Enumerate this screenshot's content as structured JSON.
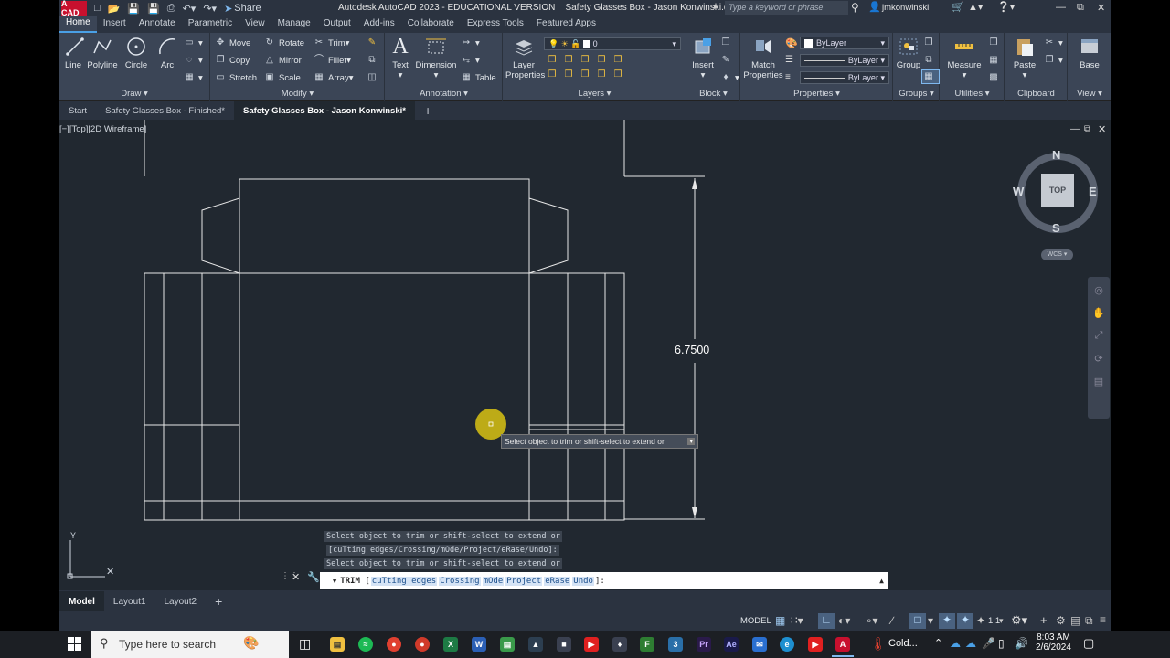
{
  "app": {
    "logo": "A CAD",
    "title": "Autodesk AutoCAD 2023 - EDUCATIONAL VERSION",
    "document": "Safety Glasses Box - Jason Konwinski.dwg",
    "share_label": "Share",
    "search_placeholder": "Type a keyword or phrase",
    "user": "jmkonwinski"
  },
  "menu_tabs": [
    "Home",
    "Insert",
    "Annotate",
    "Parametric",
    "View",
    "Manage",
    "Output",
    "Add-ins",
    "Collaborate",
    "Express Tools",
    "Featured Apps"
  ],
  "ribbon": {
    "draw": {
      "title": "Draw",
      "line": "Line",
      "polyline": "Polyline",
      "circle": "Circle",
      "arc": "Arc"
    },
    "modify": {
      "title": "Modify",
      "move": "Move",
      "rotate": "Rotate",
      "trim": "Trim",
      "copy": "Copy",
      "mirror": "Mirror",
      "fillet": "Fillet",
      "stretch": "Stretch",
      "scale": "Scale",
      "array": "Array"
    },
    "annotation": {
      "title": "Annotation",
      "text": "Text",
      "dimension": "Dimension",
      "table": "Table"
    },
    "layers": {
      "title": "Layers",
      "layer_properties_1": "Layer",
      "layer_properties_2": "Properties",
      "current_layer": "0"
    },
    "block": {
      "title": "Block",
      "insert": "Insert"
    },
    "properties": {
      "title": "Properties",
      "match_1": "Match",
      "match_2": "Properties",
      "color": "ByLayer",
      "linetype": "ByLayer",
      "lineweight": "ByLayer"
    },
    "groups": {
      "title": "Groups",
      "group": "Group"
    },
    "utilities": {
      "title": "Utilities",
      "measure": "Measure"
    },
    "clipboard": {
      "title": "Clipboard",
      "paste": "Paste"
    },
    "view": {
      "title": "View",
      "base": "Base"
    }
  },
  "file_tabs": [
    "Start",
    "Safety Glasses Box - Finished*",
    "Safety Glasses Box - Jason Konwinski*"
  ],
  "viewport_label": "[−][Top][2D Wireframe]",
  "viewcube": {
    "n": "N",
    "s": "S",
    "e": "E",
    "w": "W",
    "top": "TOP",
    "wcs": "WCS"
  },
  "drawing": {
    "dimension_value": "6.7500",
    "tooltip": "Select object to trim or shift-select to extend or"
  },
  "command": {
    "history_1": "Select object to trim or shift-select to extend or",
    "history_2": "[cuTting edges/Crossing/mOde/Project/eRase/Undo]:",
    "history_3": "Select object to trim or shift-select to extend or",
    "current_cmd": "TRIM",
    "options": [
      "cuTting edges",
      "Crossing",
      "mOde",
      "Project",
      "eRase",
      "Undo"
    ]
  },
  "layout_tabs": [
    "Model",
    "Layout1",
    "Layout2"
  ],
  "status": {
    "model": "MODEL",
    "scale": "1:1"
  },
  "taskbar": {
    "search_placeholder": "Type here to search",
    "weather": "Cold...",
    "time": "8:03 AM",
    "date": "2/6/2024"
  },
  "colors": {
    "ribbon_bg": "#3b4556",
    "canvas_bg": "#212830",
    "accent": "#4aa0e6",
    "cursor_highlight": "#d8c213"
  }
}
